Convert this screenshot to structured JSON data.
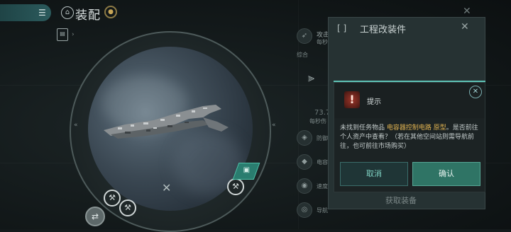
{
  "header": {
    "title": "装配",
    "menu_icon": "hamburger-menu-icon",
    "title_icon": "ship-assembly-icon",
    "settings_icon": "gear-icon"
  },
  "ship_view": {
    "left_arrow": "«",
    "right_arrow": "«",
    "center_close": "✕",
    "swap_icon": "swap-icon"
  },
  "side_stats": {
    "attack_label": "攻击",
    "attack_sub": "每秒",
    "overview_label": "综合",
    "value": "73.7",
    "value_sub": "每秒伤",
    "defense_label": "防御",
    "capacitor_label": "电容",
    "speed_label": "速度",
    "nav_label": "导航"
  },
  "engineering_panel": {
    "title": "工程改装件",
    "bracket": "[ ]",
    "footer": "获取装备"
  },
  "dialog": {
    "title": "提示",
    "message_prefix": "未找到任务物品 ",
    "item_name": "电容器控制电路 原型",
    "message_suffix": "。是否前往个人资产中查看？（若在其他空间站则需导航前往，也可前往市场购买）",
    "cancel_label": "取消",
    "confirm_label": "确认"
  },
  "colors": {
    "accent": "#2f7465",
    "highlight": "#e0b351",
    "warning": "#9a3529"
  }
}
